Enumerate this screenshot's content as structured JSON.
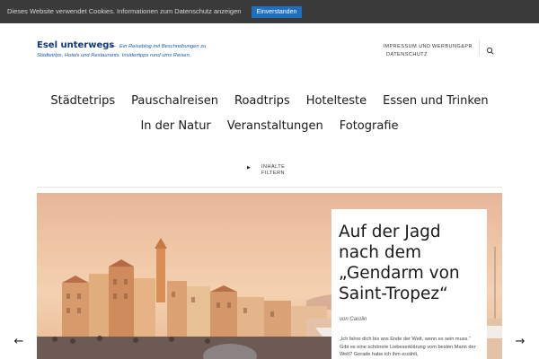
{
  "cookie_bar": {
    "message": "Dieses Website verwendet Cookies.",
    "privacy_link": "Informationen zum Datenschutz anzeigen",
    "accept_label": "Einverstanden"
  },
  "header": {
    "site_title": "Esel unterwegs",
    "dash": "—",
    "tagline": "Ein Reiseblog mit Beschreibungen zu Städtetrips, Hotels und Restaurants. Insidertipps rund ums Reisen.",
    "top_links": [
      "IMPRESSUM UND DATENSCHUTZ",
      "WERBUNG&PR"
    ],
    "search_icon": "search-icon"
  },
  "nav": {
    "row1": [
      "Städtetrips",
      "Pauschalreisen",
      "Roadtrips",
      "Hotelteste",
      "Essen und Trinken"
    ],
    "row2": [
      "In der Natur",
      "Veranstaltungen",
      "Fotografie"
    ]
  },
  "filter": {
    "arrow": "▶",
    "label": "INHALTE FILTERN"
  },
  "hero": {
    "title": "Auf der Jagd nach dem „Gendarm von Saint-Tropez“",
    "author": "von Carolin",
    "excerpt": "„Ich fahre dich bis ans Ende der Welt, wenn es sein muss.“ Gibt es eine schönere Liebeserklärung vom besten Mann der Welt? Gerade habe ich ihm erzählt,",
    "prev_arrow": "←",
    "next_arrow": "→"
  },
  "colors": {
    "cookie_bg": "#3a3a3a",
    "accept_bg": "#1f6fc1",
    "title_blue": "#0e3a77",
    "tagline_blue": "#1a5aa6"
  }
}
